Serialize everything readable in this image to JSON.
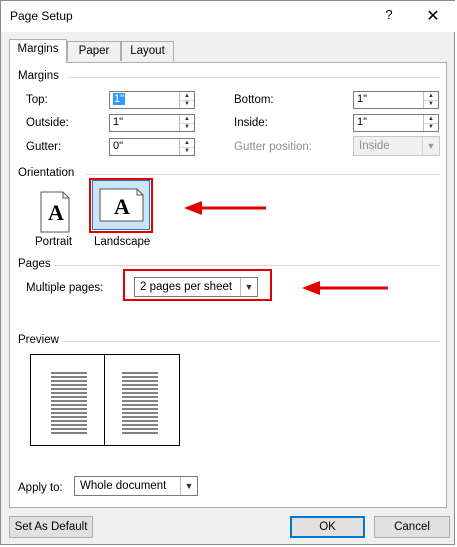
{
  "window": {
    "title": "Page Setup",
    "help": "?",
    "close": "✕"
  },
  "tabs": [
    {
      "label": "Margins",
      "active": true
    },
    {
      "label": "Paper",
      "active": false
    },
    {
      "label": "Layout",
      "active": false
    }
  ],
  "margins": {
    "section": "Margins",
    "top": {
      "label": "Top:",
      "value": "1\""
    },
    "bottom": {
      "label": "Bottom:",
      "value": "1\""
    },
    "outside": {
      "label": "Outside:",
      "value": "1\""
    },
    "inside": {
      "label": "Inside:",
      "value": "1\""
    },
    "gutter": {
      "label": "Gutter:",
      "value": "0\""
    },
    "gutter_position": {
      "label": "Gutter position:",
      "value": "Inside"
    }
  },
  "orientation": {
    "section": "Orientation",
    "portrait": {
      "label": "Portrait",
      "glyph": "A"
    },
    "landscape": {
      "label": "Landscape",
      "glyph": "A"
    }
  },
  "pages": {
    "section": "Pages",
    "multiple_pages_label": "Multiple pages:",
    "multiple_pages_value": "2 pages per sheet"
  },
  "preview": {
    "section": "Preview"
  },
  "apply": {
    "label": "Apply to:",
    "value": "Whole document"
  },
  "buttons": {
    "default": "Set As Default",
    "ok": "OK",
    "cancel": "Cancel"
  },
  "colors": {
    "annotation": "#e00000",
    "accent": "#0078d7",
    "selection": "#3399ff"
  }
}
